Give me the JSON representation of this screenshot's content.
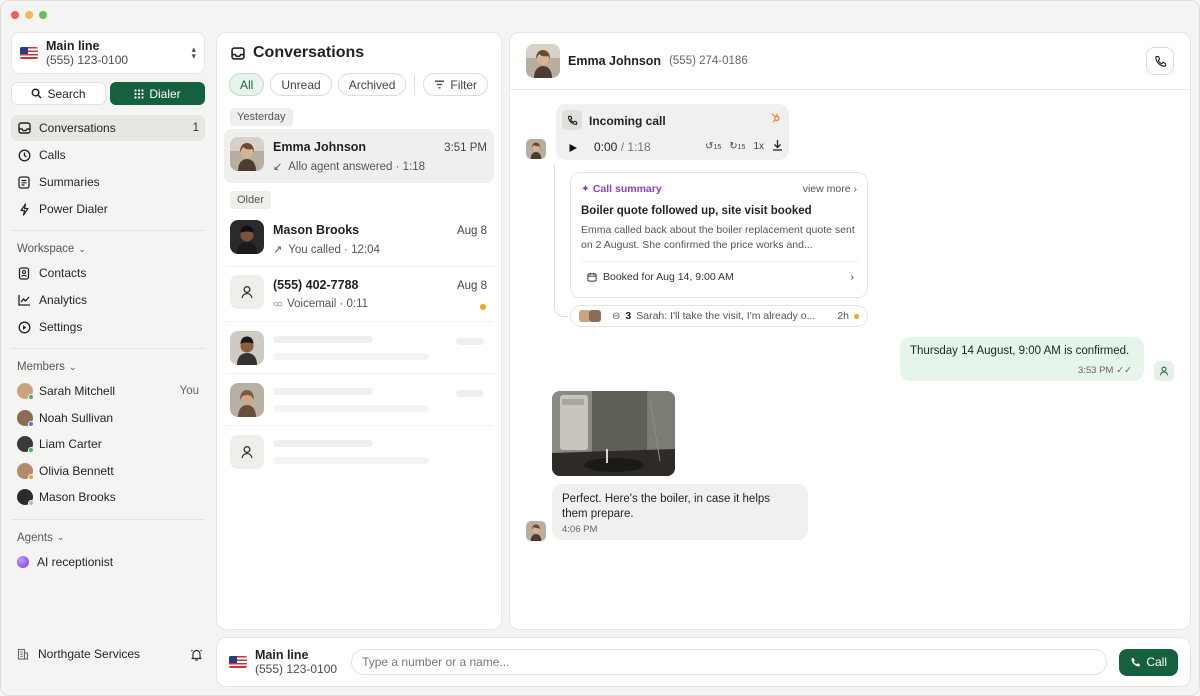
{
  "window": {
    "traffic_colors": [
      "#ee5f57",
      "#f4bd4f",
      "#5fc453"
    ]
  },
  "line": {
    "name": "Main line",
    "number": "(555) 123-0100"
  },
  "modes": {
    "search": "Search",
    "dialer": "Dialer"
  },
  "nav": [
    {
      "label": "Conversations",
      "count": "1",
      "icon": "inbox-icon"
    },
    {
      "label": "Calls",
      "icon": "clock-icon"
    },
    {
      "label": "Summaries",
      "icon": "document-icon"
    },
    {
      "label": "Power Dialer",
      "icon": "bolt-icon"
    }
  ],
  "workspace": {
    "title": "Workspace",
    "items": [
      {
        "label": "Contacts",
        "icon": "contacts-icon"
      },
      {
        "label": "Analytics",
        "icon": "chart-icon"
      },
      {
        "label": "Settings",
        "icon": "settings-icon"
      }
    ]
  },
  "members": {
    "title": "Members",
    "you_label": "You",
    "items": [
      {
        "name": "Sarah Mitchell",
        "status_color": "#3cb55e",
        "avatar_color": "#c9a57d"
      },
      {
        "name": "Noah Sullivan",
        "status_color": "#4d7be0",
        "avatar_color": "#8d6b55"
      },
      {
        "name": "Liam Carter",
        "status_color": "#3cb55e",
        "avatar_color": "#3a3a3a"
      },
      {
        "name": "Olivia Bennett",
        "status_color": "#e6a81f",
        "avatar_color": "#b58a6a"
      },
      {
        "name": "Mason Brooks",
        "status_color": "#b8b8b4",
        "avatar_color": "#2b2b2b"
      }
    ]
  },
  "agents": {
    "title": "Agents",
    "items": [
      {
        "name": "AI receptionist"
      }
    ]
  },
  "org": {
    "name": "Northgate Services"
  },
  "conversations": {
    "title": "Conversations",
    "filters": {
      "all": "All",
      "unread": "Unread",
      "archived": "Archived",
      "filter": "Filter"
    },
    "groups": {
      "yesterday": "Yesterday",
      "older": "Older"
    },
    "items": [
      {
        "name": "Emma Johnson",
        "time": "3:51 PM",
        "sub": "Allo agent answered · 1:18",
        "icon": "incoming-arrow-icon"
      },
      {
        "name": "Mason Brooks",
        "time": "Aug 8",
        "sub": "You called · 12:04",
        "icon": "outgoing-arrow-icon"
      },
      {
        "name": "(555) 402-7788",
        "time": "Aug 8",
        "sub": "Voicemail · 0:11",
        "icon": "voicemail-icon",
        "unread": true
      }
    ]
  },
  "chat": {
    "contact_name": "Emma Johnson",
    "contact_phone": "(555) 274-0186",
    "call": {
      "title": "Incoming call",
      "elapsed": "0:00",
      "duration": "/ 1:18",
      "back": "15",
      "fwd": "15",
      "speed": "1x"
    },
    "summary": {
      "tag": "Call summary",
      "more": "view more",
      "title": "Boiler quote followed up, site visit booked",
      "body": "Emma called back about the boiler replacement quote sent on 2 August. She confirmed the price works and...",
      "booking": "Booked for Aug 14, 9:00 AM"
    },
    "replies": {
      "count": "3",
      "preview": "Sarah: I'll take the visit, I'm already o...",
      "ago": "2h"
    },
    "outgoing": {
      "text": "Thursday 14 August, 9:00 AM is confirmed.",
      "time": "3:53 PM"
    },
    "incoming": {
      "text": "Perfect. Here's the boiler, in case it helps them prepare.",
      "time": "4:06 PM"
    }
  },
  "dialer": {
    "line_name": "Main line",
    "line_number": "(555) 123-0100",
    "placeholder": "Type a number or a name...",
    "call_label": "Call"
  },
  "colors": {
    "accent": "#15603f",
    "unread": "#e6a81f",
    "summary_purple": "#8a3fc7"
  }
}
